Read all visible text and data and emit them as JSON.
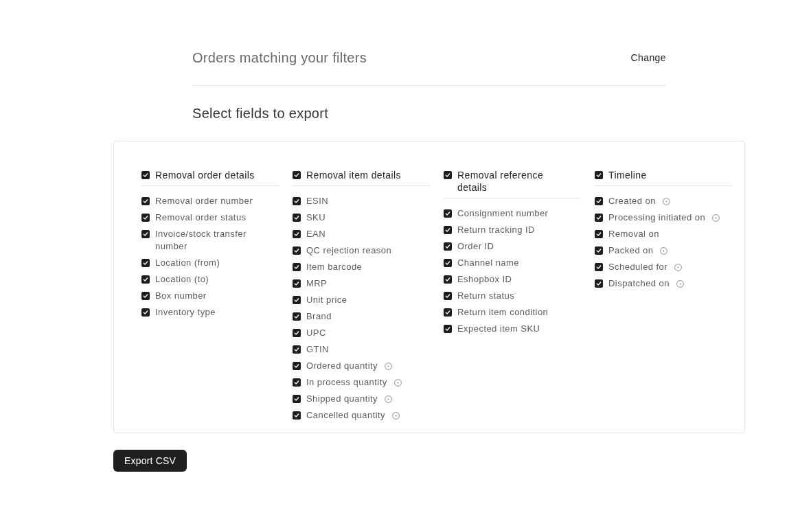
{
  "filters": {
    "title": "Orders matching your filters",
    "action": "Change"
  },
  "section_title": "Select fields to export",
  "groups": [
    {
      "label": "Removal order details",
      "checked": true,
      "fields": [
        {
          "label": "Removal order number",
          "checked": true,
          "info": false
        },
        {
          "label": "Removal order status",
          "checked": true,
          "info": false
        },
        {
          "label": "Invoice/stock transfer number",
          "checked": true,
          "info": false
        },
        {
          "label": "Location (from)",
          "checked": true,
          "info": false
        },
        {
          "label": "Location (to)",
          "checked": true,
          "info": false
        },
        {
          "label": "Box number",
          "checked": true,
          "info": false
        },
        {
          "label": "Inventory type",
          "checked": true,
          "info": false
        }
      ]
    },
    {
      "label": "Removal item details",
      "checked": true,
      "fields": [
        {
          "label": "ESIN",
          "checked": true,
          "info": false
        },
        {
          "label": "SKU",
          "checked": true,
          "info": false
        },
        {
          "label": "EAN",
          "checked": true,
          "info": false
        },
        {
          "label": "QC rejection reason",
          "checked": true,
          "info": false
        },
        {
          "label": "Item barcode",
          "checked": true,
          "info": false
        },
        {
          "label": "MRP",
          "checked": true,
          "info": false
        },
        {
          "label": "Unit price",
          "checked": true,
          "info": false
        },
        {
          "label": "Brand",
          "checked": true,
          "info": false
        },
        {
          "label": "UPC",
          "checked": true,
          "info": false
        },
        {
          "label": "GTIN",
          "checked": true,
          "info": false
        },
        {
          "label": "Ordered quantity",
          "checked": true,
          "info": true
        },
        {
          "label": "In process quantity",
          "checked": true,
          "info": true
        },
        {
          "label": "Shipped quantity",
          "checked": true,
          "info": true
        },
        {
          "label": "Cancelled quantity",
          "checked": true,
          "info": true
        }
      ]
    },
    {
      "label": "Removal reference details",
      "checked": true,
      "fields": [
        {
          "label": "Consignment number",
          "checked": true,
          "info": false
        },
        {
          "label": "Return tracking ID",
          "checked": true,
          "info": false
        },
        {
          "label": "Order ID",
          "checked": true,
          "info": false
        },
        {
          "label": "Channel name",
          "checked": true,
          "info": false
        },
        {
          "label": "Eshopbox ID",
          "checked": true,
          "info": false
        },
        {
          "label": "Return status",
          "checked": true,
          "info": false
        },
        {
          "label": "Return item condition",
          "checked": true,
          "info": false
        },
        {
          "label": "Expected item SKU",
          "checked": true,
          "info": false
        }
      ]
    },
    {
      "label": "Timeline",
      "checked": true,
      "fields": [
        {
          "label": "Created on",
          "checked": true,
          "info": true
        },
        {
          "label": "Processing initiated on",
          "checked": true,
          "info": true
        },
        {
          "label": "Removal on",
          "checked": true,
          "info": false
        },
        {
          "label": "Packed on",
          "checked": true,
          "info": true
        },
        {
          "label": "Scheduled for",
          "checked": true,
          "info": true
        },
        {
          "label": "Dispatched on",
          "checked": true,
          "info": true
        }
      ]
    }
  ],
  "buttons": [
    "Export CSV"
  ]
}
